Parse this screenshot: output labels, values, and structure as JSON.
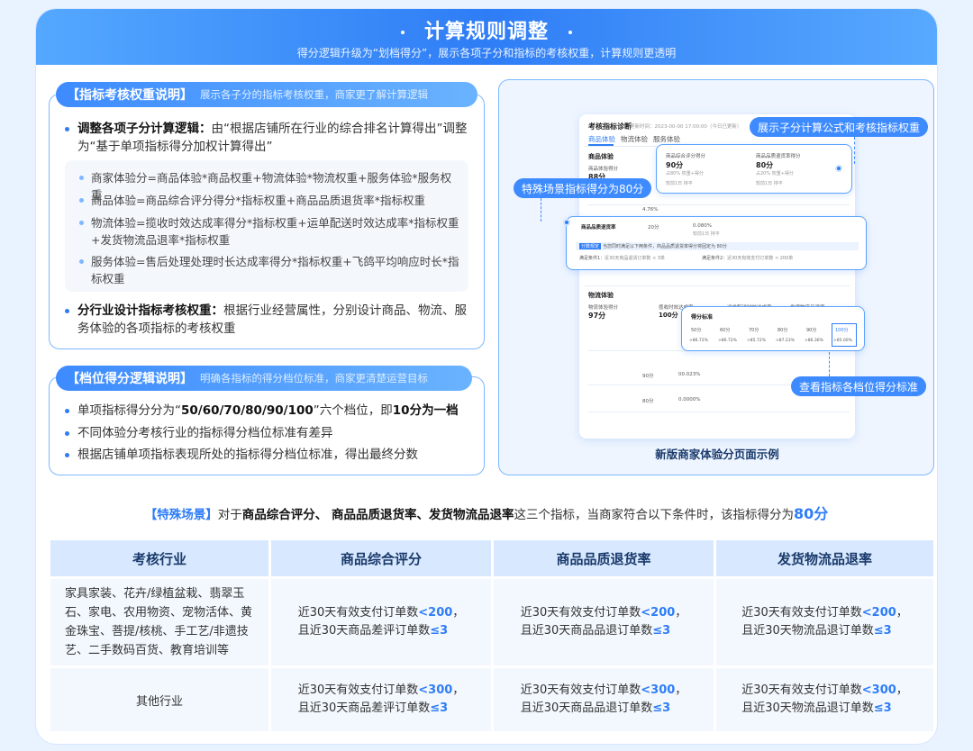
{
  "header": {
    "title": "计算规则调整",
    "subtitle": "得分逻辑升级为“划档得分”，展示各项子分和指标的考核权重，计算规则更透明"
  },
  "weight_section": {
    "tag": "【指标考核权重说明】",
    "tag_desc": "展示各子分的指标考核权重，商家更了解计算逻辑",
    "b1_bold": "调整各项子分计算逻辑：",
    "b1_text": "由“根据店铺所在行业的综合排名计算得出”调整为“基于单项指标得分加权计算得出”",
    "sub": [
      "商家体验分=商品体验*商品权重+物流体验*物流权重+服务体验*服务权重",
      "商品体验=商品综合评分得分*指标权重+商品品质退货率*指标权重",
      "物流体验=揽收时效达成率得分*指标权重+运单配送时效达成率*指标权重+发货物流品退率*指标权重",
      "服务体验=售后处理处理时长达成率得分*指标权重+飞鸽平均响应时长*指标权重"
    ],
    "b2_bold": "分行业设计指标考核权重：",
    "b2_text": "根据行业经营属性，分别设计商品、物流、服务体验的各项指标的考核权重"
  },
  "tier_section": {
    "tag": "【档位得分逻辑说明】",
    "tag_desc": "明确各指标的得分档位标准，商家更清楚运营目标",
    "b1_pre": "单项指标得分分为“",
    "b1_quote": "50/60/70/80/90/100",
    "b1_post": "”六个档位，即",
    "b1_bold2": "10分为一档",
    "b2": "不同体验分考核行业的指标得分档位标准有差异",
    "b3": "根据店铺单项指标表现所处的指标得分档位标准，得出最终分数"
  },
  "mockup": {
    "caption": "新版商家体验分页面示例",
    "title": "考核指标诊断",
    "title_meta": "更新时间：2023-00-00 17:00:00（今日已更新）",
    "tabs": [
      "商品体验",
      "物流体验",
      "服务体验"
    ],
    "goods_label": "商品体验",
    "goods_sub": "商品体验得分",
    "goods_score": "88分",
    "callout1": {
      "a_label": "商品综合评分得分",
      "a_val": "90分",
      "a_meta": "占80% 权重+得分",
      "a_note": "较前1日 持平",
      "b_label": "商品品质退货率得分",
      "b_val": "80分",
      "b_meta": "占20% 权重+得分",
      "b_note": "较前1日 持平"
    },
    "callout2": {
      "name": "商品品质退货率",
      "score": "20分",
      "rate": "0.080%",
      "note": "较前1日 持平",
      "tag": "分数规定",
      "tag_text": "当您同时满足以下两条件，商品品质退货率得分将固定为 80分",
      "cond1": "满足条件1：",
      "cond1_v": "近30天商品退货订单数 < 3单",
      "cond2": "满足条件2：",
      "cond2_v": "近30天有效支付订单数 < 200单"
    },
    "grid_label": "得分标准",
    "grid_tiers": [
      "50分",
      "60分",
      "70分",
      "80分",
      "90分",
      "100分"
    ],
    "grid_vals": [
      ">86.72%",
      ">86.72%",
      ">85.72%",
      ">87.23%",
      ">86.36%",
      ">85.00%"
    ],
    "logistics_label": "物流体验",
    "logistics_sub": "物流体验得分",
    "logistics_score": "97分",
    "logistics_items": [
      "揽收时效达成率",
      "运单配送时效达成率",
      "发货物流品退率"
    ],
    "logistics_vals": [
      "100分",
      "90分",
      "80分"
    ],
    "mini_vals": [
      "4.76%",
      "00.023%",
      "0.0000%"
    ],
    "pill1": "展示子分计算公式和考核指标权重",
    "pill2": "特殊场景指标得分为80分",
    "pill3": "查看指标各档位得分标准"
  },
  "special": {
    "kw": "【特殊场景】",
    "pre": "对于",
    "bold": "商品综合评分、 商品品质退货率、发货物流品退率",
    "mid": "这三个指标，当商家符合以下条件时，该指标得分为",
    "score": "80分"
  },
  "table": {
    "headers": [
      "考核行业",
      "商品综合评分",
      "商品品质退货率",
      "发货物流品退率"
    ],
    "rows": [
      {
        "industry": "家具家装、花卉/绿植盆栽、翡翠玉石、家电、农用物资、宠物活体、黄金珠宝、菩提/核桃、手工艺/非遗技艺、二手数码百货、教育培训等",
        "cells": [
          {
            "l1": "近30天有效支付订单数",
            "v1": "<200",
            "l2": "且近30天商品差评订单数",
            "v2": "≤3"
          },
          {
            "l1": "近30天有效支付订单数",
            "v1": "<200",
            "l2": "且近30天商品品退订单数",
            "v2": "≤3"
          },
          {
            "l1": "近30天有效支付订单数",
            "v1": "<200",
            "l2": "且近30天物流品退订单数",
            "v2": "≤3"
          }
        ]
      },
      {
        "industry": "其他行业",
        "cells": [
          {
            "l1": "近30天有效支付订单数",
            "v1": "<300",
            "l2": "且近30天商品差评订单数",
            "v2": "≤3"
          },
          {
            "l1": "近30天有效支付订单数",
            "v1": "<300",
            "l2": "且近30天商品品退订单数",
            "v2": "≤3"
          },
          {
            "l1": "近30天有效支付订单数",
            "v1": "<300",
            "l2": "且近30天物流品退订单数",
            "v2": "≤3"
          }
        ]
      }
    ]
  },
  "colors": {
    "accent": "#2f7df6",
    "light": "#d8e9ff"
  }
}
